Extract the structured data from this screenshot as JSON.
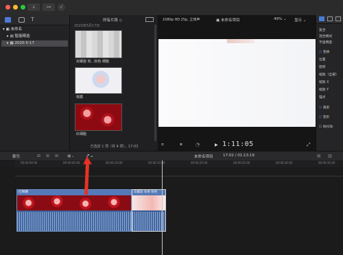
{
  "topbar": {
    "traffic_colors": [
      "#ff5f57",
      "#febc2e",
      "#28c840"
    ],
    "buttons": [
      "↓",
      "⊶",
      "✓"
    ]
  },
  "library": {
    "items": [
      {
        "label": "未命名",
        "expanded": true
      },
      {
        "label": "智能精选",
        "expanded": false
      },
      {
        "label": "2020-5-17",
        "expanded": false
      }
    ]
  },
  "browser": {
    "filter_label": "所有片段",
    "header_date": "2020年5月17日",
    "clips": [
      {
        "name": "双螺旋 效...粉色 细胞"
      },
      {
        "name": "核膜"
      },
      {
        "name": "红细胞"
      }
    ],
    "status": "已选定 1 项（共 4 项），17:03"
  },
  "viewer": {
    "format": "1080p HD 25p, 立体声",
    "project_name": "未命名项目",
    "zoom": "49%",
    "display_label": "显示",
    "timecode": "1:11:05"
  },
  "inspector": {
    "rows": [
      {
        "label": "复合",
        "checked": null
      },
      {
        "label": "混合模式",
        "checked": null
      },
      {
        "label": "不透明度",
        "checked": null
      },
      {
        "label": "变换",
        "checked": true
      },
      {
        "label": "位置",
        "checked": null
      },
      {
        "label": "旋转",
        "checked": null
      },
      {
        "label": "缩放（全部）",
        "checked": null
      },
      {
        "label": "缩放 X",
        "checked": null
      },
      {
        "label": "缩放 Y",
        "checked": null
      },
      {
        "label": "锚点",
        "checked": null
      },
      {
        "label": "裁剪",
        "checked": true
      },
      {
        "label": "变形",
        "checked": true
      },
      {
        "label": "防抖动",
        "checked": false
      }
    ]
  },
  "timeline": {
    "index_label": "索引",
    "project_title": "未命名项目",
    "duration": "17:02 / 01:13:19",
    "ruler_ticks": [
      "00:00:00:00",
      "00:00:05:00",
      "00:00:10:00",
      "00:00:15:00",
      "00:00:20:00",
      "00:00:25:00",
      "00:00:30:00",
      "00:00:35:00",
      "00:00:40:00",
      "00:00:45:00",
      "00:00:50:00"
    ],
    "clips": [
      {
        "name": "红细胞"
      },
      {
        "name": "双螺旋 效果 粉色"
      }
    ]
  },
  "colors": {
    "annotation_arrow": "#e63226",
    "accent": "#3a6fd8"
  }
}
